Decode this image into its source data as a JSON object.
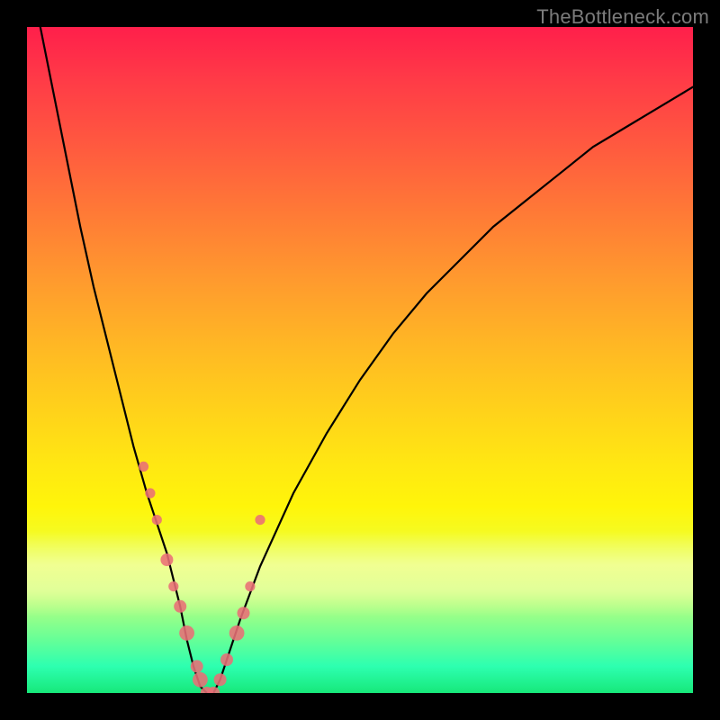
{
  "watermark": "TheBottleneck.com",
  "chart_data": {
    "type": "line",
    "title": "",
    "xlabel": "",
    "ylabel": "",
    "xlim": [
      0,
      100
    ],
    "ylim": [
      0,
      100
    ],
    "grid": false,
    "annotations": [],
    "x": [
      0,
      2,
      4,
      6,
      8,
      10,
      12,
      14,
      16,
      18,
      19,
      20,
      21,
      22,
      23,
      24,
      25,
      26,
      27,
      28,
      29,
      30,
      32,
      35,
      40,
      45,
      50,
      55,
      60,
      65,
      70,
      75,
      80,
      85,
      90,
      95,
      100
    ],
    "values": [
      110,
      100,
      90,
      80,
      70,
      61,
      53,
      45,
      37,
      30,
      27,
      24,
      21,
      17,
      13,
      8,
      4,
      1,
      0,
      0,
      2,
      5,
      11,
      19,
      30,
      39,
      47,
      54,
      60,
      65,
      70,
      74,
      78,
      82,
      85,
      88,
      91
    ],
    "markers": {
      "type": "scatter",
      "color": "#e96e76",
      "x": [
        17.5,
        18.5,
        19.5,
        21.0,
        22.0,
        23.0,
        24.0,
        25.5,
        26.0,
        27.0,
        28.0,
        29.0,
        30.0,
        31.5,
        32.5,
        33.5,
        35.0
      ],
      "values": [
        34,
        30,
        26,
        20,
        16,
        13,
        9,
        4,
        2,
        0,
        0,
        2,
        5,
        9,
        12,
        16,
        26
      ],
      "sizes": [
        8,
        8,
        8,
        10,
        8,
        10,
        12,
        10,
        12,
        10,
        10,
        10,
        10,
        12,
        10,
        8,
        8
      ]
    },
    "background": {
      "type": "vertical-gradient",
      "direction": "top-to-bottom",
      "stops": [
        {
          "pos": 0.0,
          "color": "#ff1f4b"
        },
        {
          "pos": 0.18,
          "color": "#ff5a3f"
        },
        {
          "pos": 0.38,
          "color": "#ff9a2e"
        },
        {
          "pos": 0.58,
          "color": "#ffd31a"
        },
        {
          "pos": 0.72,
          "color": "#fff50a"
        },
        {
          "pos": 0.88,
          "color": "#9dff87"
        },
        {
          "pos": 1.0,
          "color": "#17e87a"
        }
      ]
    }
  }
}
